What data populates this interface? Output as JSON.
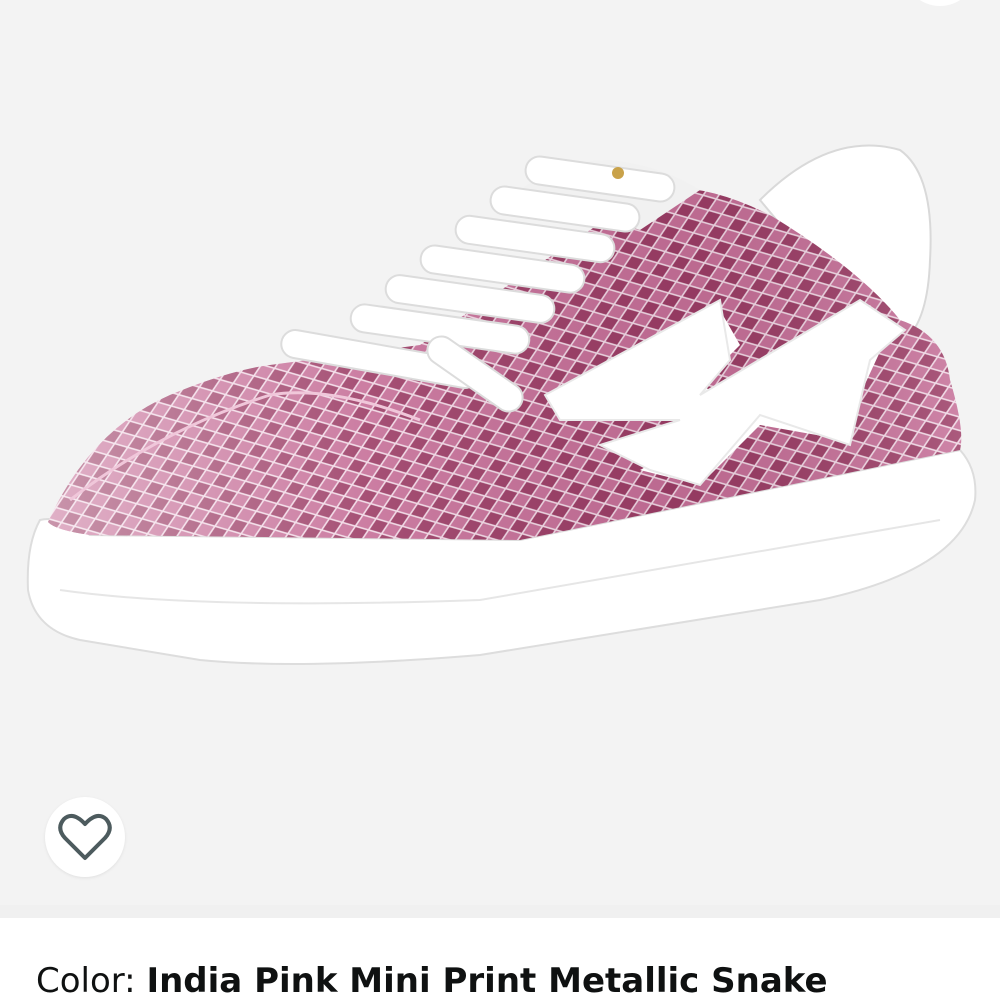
{
  "product": {
    "image_alt": "India Pink Mini Print Metallic Snake low-top sneaker",
    "color_label": "Color:",
    "color_value": "India Pink Mini Print Metallic Snake"
  },
  "wishlist": {
    "icon": "heart-outline-icon"
  },
  "colors": {
    "background": "#f3f3f3",
    "metallic_pink": "#a8446f",
    "sole": "#ffffff",
    "text": "#0f1111"
  }
}
